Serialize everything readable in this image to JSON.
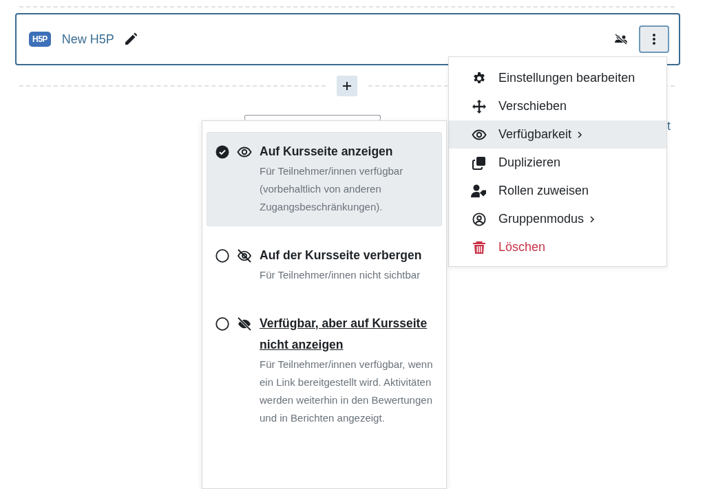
{
  "activity": {
    "logo_text": "H5P",
    "title": "New H5P",
    "menu_open": true
  },
  "background": {
    "link_fragment": "t"
  },
  "action_menu": {
    "items": [
      {
        "kind": "gear",
        "label": "Einstellungen bearbeiten",
        "submenu": false,
        "selected": false,
        "danger": false
      },
      {
        "kind": "move",
        "label": "Verschieben",
        "submenu": false,
        "selected": false,
        "danger": false
      },
      {
        "kind": "eye",
        "label": "Verfügbarkeit",
        "submenu": true,
        "selected": true,
        "danger": false
      },
      {
        "kind": "copy",
        "label": "Duplizieren",
        "submenu": false,
        "selected": false,
        "danger": false
      },
      {
        "kind": "usertag",
        "label": "Rollen zuweisen",
        "submenu": false,
        "selected": false,
        "danger": false
      },
      {
        "kind": "usercircle",
        "label": "Gruppenmodus",
        "submenu": true,
        "selected": false,
        "danger": false
      },
      {
        "kind": "trash",
        "label": "Löschen",
        "submenu": false,
        "selected": false,
        "danger": true
      }
    ]
  },
  "availability_menu": {
    "options": [
      {
        "kind": "show",
        "title": "Auf Kursseite anzeigen",
        "description": "Für Teilnehmer/innen verfügbar (vorbehaltlich von anderen Zugangsbeschränkungen).",
        "selected": true,
        "hovered": false
      },
      {
        "kind": "hide",
        "title": "Auf der Kursseite verbergen",
        "description": "Für Teilnehmer/innen nicht sichtbar",
        "selected": false,
        "hovered": false
      },
      {
        "kind": "stealth",
        "title": "Verfügbar, aber auf Kursseite nicht anzeigen",
        "description": "Für Teilnehmer/innen verfügbar, wenn ein Link bereitgestellt wird. Aktivitäten werden weiterhin in den Bewertungen und in Berichten angezeigt.",
        "selected": false,
        "hovered": true
      }
    ]
  }
}
